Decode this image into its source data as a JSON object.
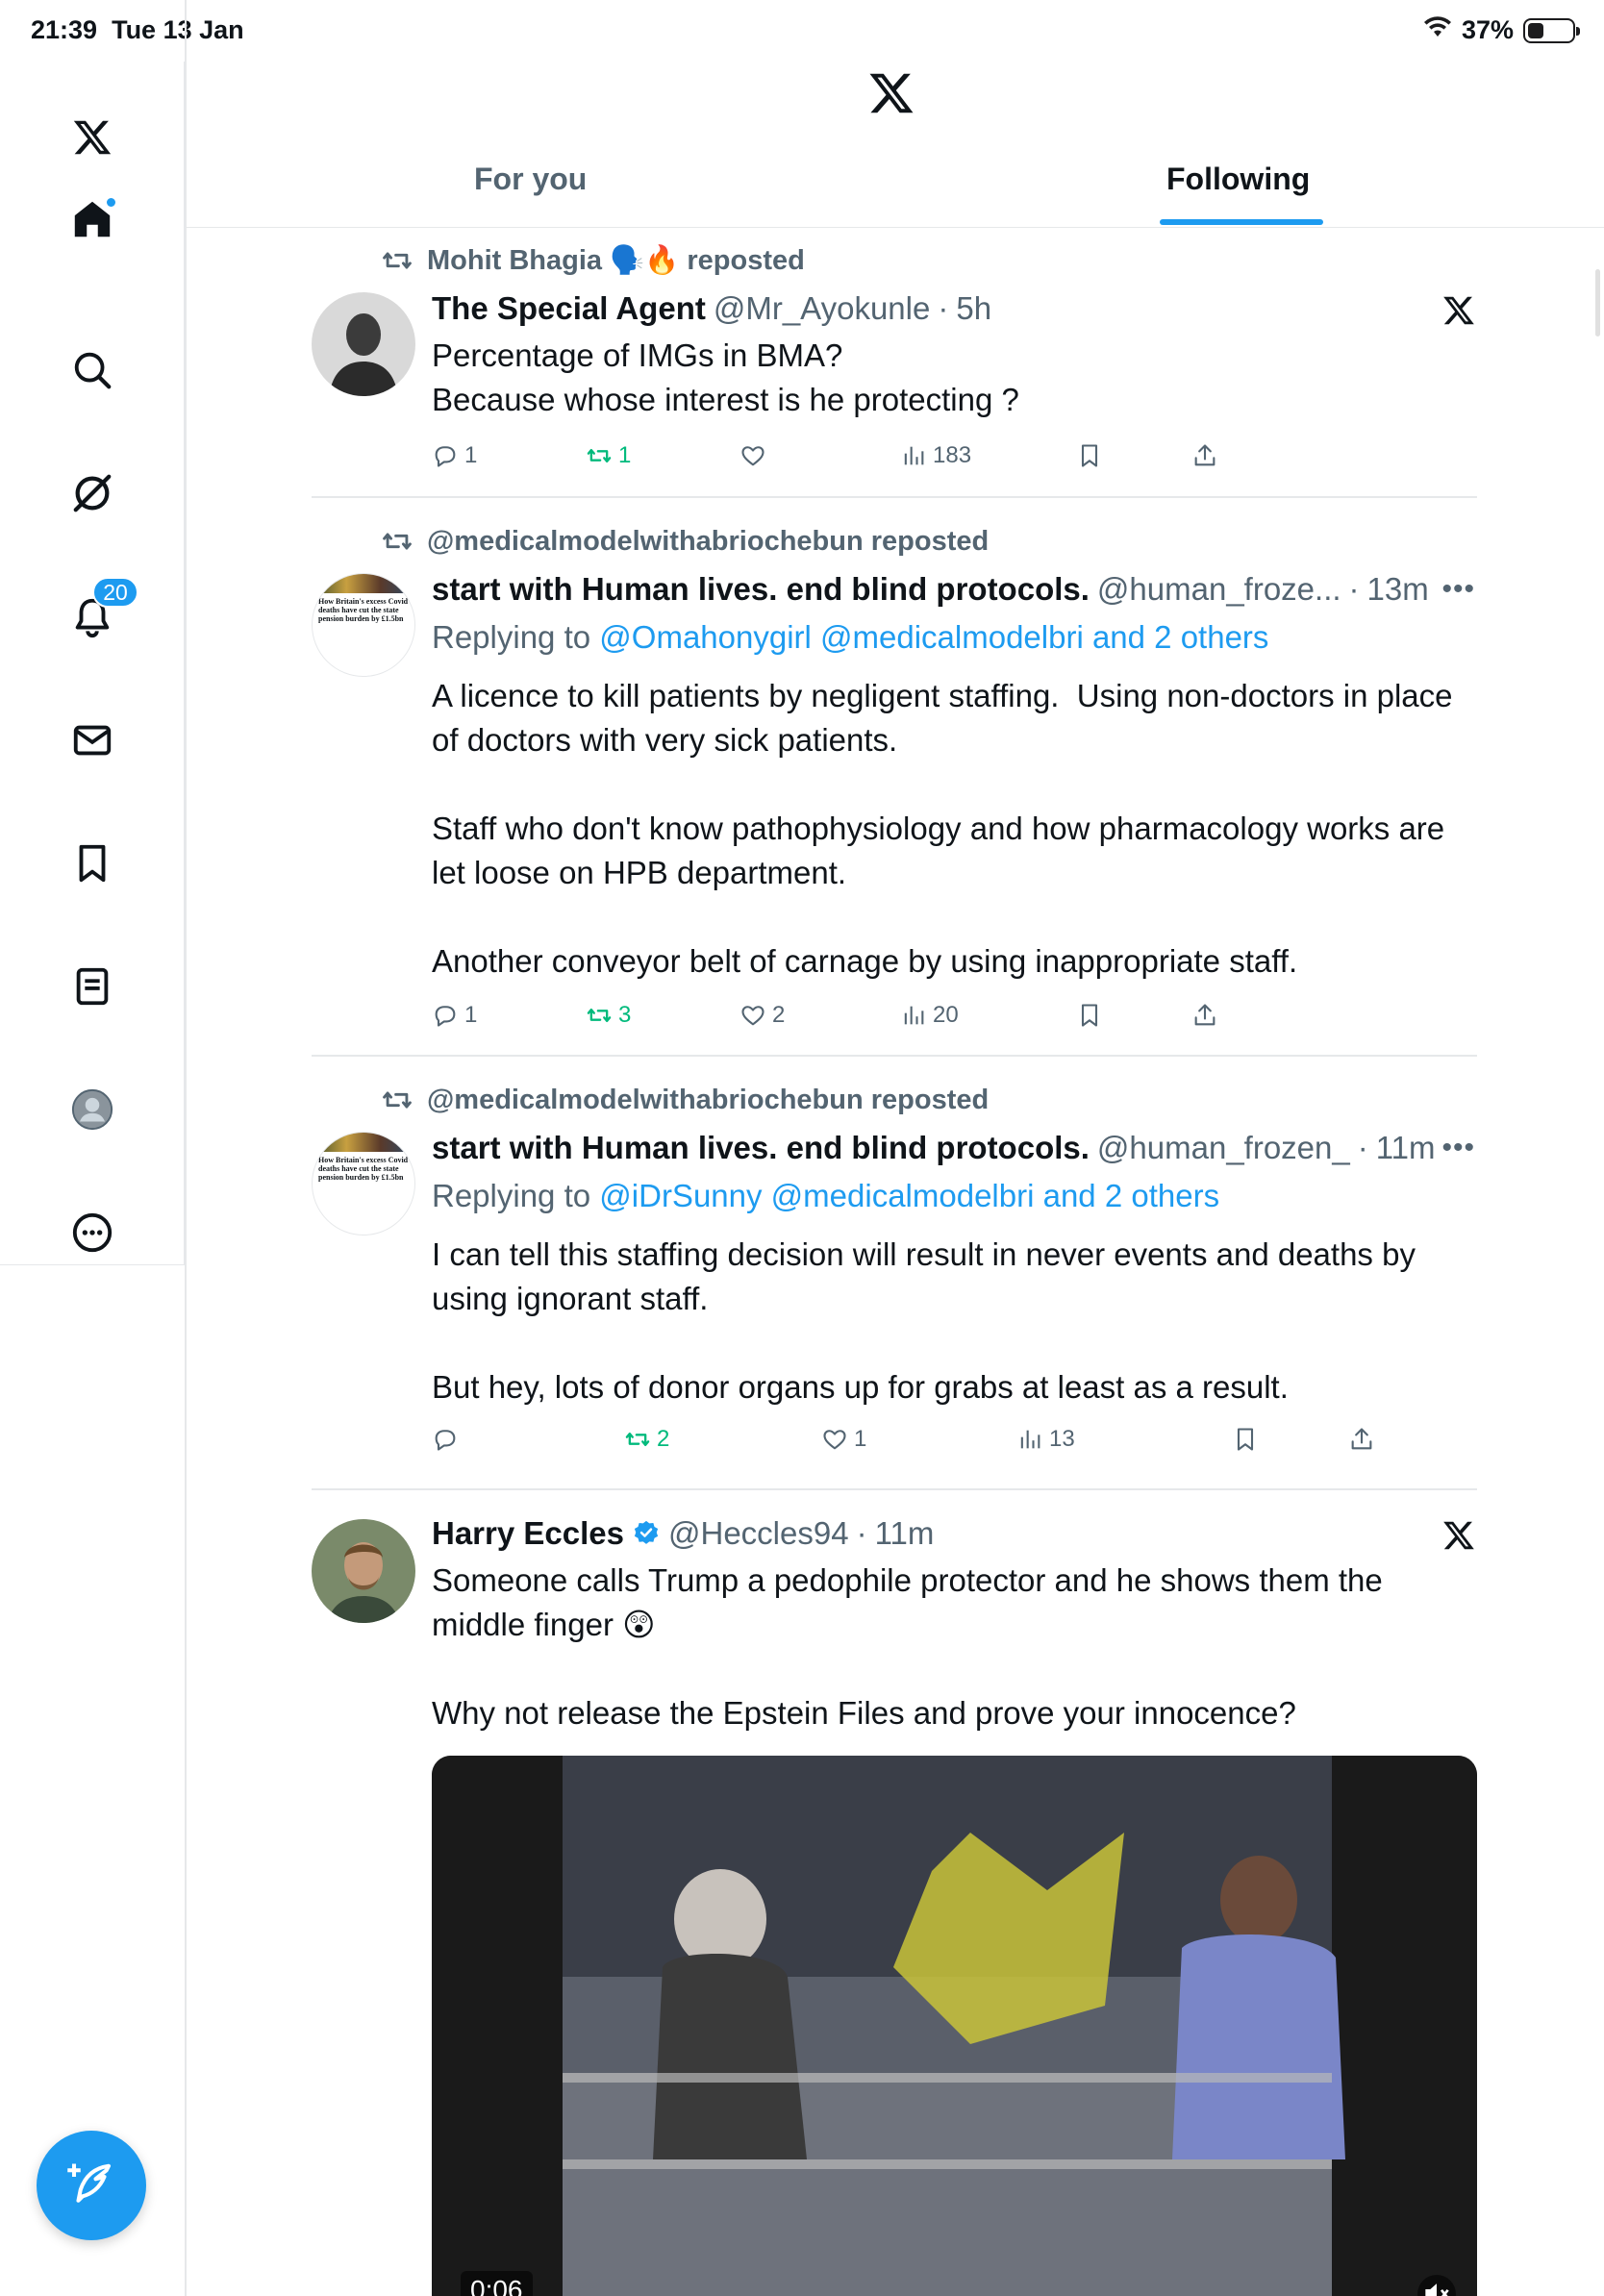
{
  "status_bar": {
    "time": "21:39",
    "date": "Tue 13 Jan",
    "battery": "37%",
    "battery_level": 0.37
  },
  "sidebar": {
    "notifications_count": "20",
    "items": [
      "x-logo",
      "home-icon",
      "search-icon",
      "grok-icon",
      "bell-icon",
      "mail-icon",
      "bookmark-icon",
      "lists-icon",
      "profile-icon",
      "more-icon"
    ]
  },
  "header": {
    "tabs": [
      {
        "label": "For you"
      },
      {
        "label": "Following"
      }
    ],
    "active_tab": "Following"
  },
  "tweets": [
    {
      "repost_by": "Mohit Bhagia 🗣️🔥 reposted",
      "name": "The Special Agent",
      "handle": "@Mr_Ayokunle",
      "time": "5h",
      "body": "Percentage of IMGs in BMA?\nBecause whose interest is he protecting ?",
      "replies": "1",
      "reposts": "1",
      "likes": "",
      "views": "183"
    },
    {
      "repost_by": "@medicalmodelwithabriochebun reposted",
      "name": "start with Human lives. end blind protocols.",
      "handle": "@human_froze...",
      "time": "13m",
      "replying_prefix": "Replying to",
      "replying_to": "@Omahonygirl @medicalmodelbri and 2 others",
      "body": "A licence to kill patients by negligent staffing.  Using non-doctors in place of doctors with very sick patients.\n\nStaff who don't know pathophysiology and how pharmacology works are let loose on HPB department.\n\nAnother conveyor belt of carnage by using inappropriate staff.",
      "replies": "1",
      "reposts": "3",
      "likes": "2",
      "views": "20",
      "avatar_text": "How Britain's excess Covid deaths have cut the state pension burden by £1.5bn"
    },
    {
      "repost_by": "@medicalmodelwithabriochebun reposted",
      "name": "start with Human lives. end blind protocols.",
      "handle": "@human_frozen_",
      "time": "11m",
      "replying_prefix": "Replying to",
      "replying_to": "@iDrSunny @medicalmodelbri and 2 others",
      "body": "I can tell this staffing decision will result in never events and deaths by using ignorant staff.\n\nBut hey, lots of donor organs up for grabs at least as a result.",
      "replies": "",
      "reposts": "2",
      "likes": "1",
      "views": "13",
      "avatar_text": "How Britain's excess Covid deaths have cut the state pension burden by £1.5bn"
    },
    {
      "name": "Harry Eccles",
      "handle": "@Heccles94",
      "time": "11m",
      "body": "Someone calls Trump a pedophile protector and he shows them the middle finger 😲\n\nWhy not release the Epstein Files and prove your innocence?",
      "video_time": "0:06"
    }
  ],
  "colors": {
    "accent": "#1d9bf0",
    "repost_green": "#00ba7c",
    "muted": "#536471"
  }
}
